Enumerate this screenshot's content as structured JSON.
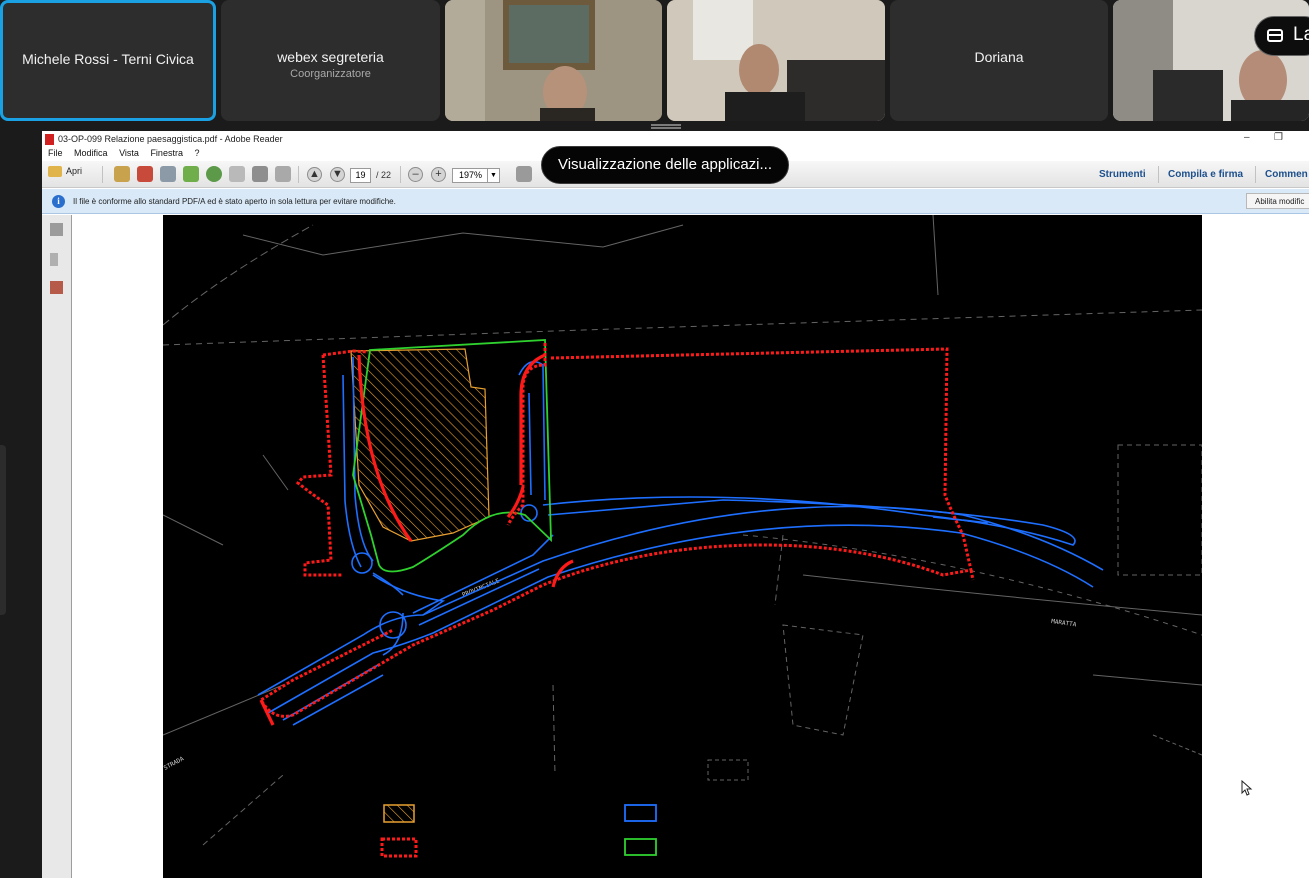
{
  "meeting": {
    "participants": [
      {
        "name": "Michele Rossi - Terni Civica",
        "role": "",
        "active": true
      },
      {
        "name": "webex segreteria",
        "role": "Coorganizzatore",
        "active": false
      },
      {
        "name": "",
        "role": "",
        "active": false,
        "video": true
      },
      {
        "name": "",
        "role": "",
        "active": false,
        "video": true
      },
      {
        "name": "Doriana",
        "role": "",
        "active": false
      },
      {
        "name": "",
        "role": "",
        "active": false,
        "video": true
      }
    ],
    "layout_button_label": "La",
    "share_tooltip": "Visualizzazione delle applicazi..."
  },
  "reader": {
    "window_title": "03-OP-099 Relazione paesaggistica.pdf - Adobe Reader",
    "window_controls": {
      "minimize": "–",
      "restore": "❐"
    },
    "menu": [
      "File",
      "Modifica",
      "Vista",
      "Finestra",
      "?"
    ],
    "toolbar": {
      "open_label": "Apri",
      "current_page": "19",
      "total_pages": "/ 22",
      "zoom": "197%",
      "zoom_out": "–",
      "zoom_in": "+",
      "right_tools": [
        "Strumenti",
        "Compila e firma",
        "Commen"
      ]
    },
    "infobar": {
      "message": "Il file è conforme allo standard PDF/A ed è stato aperto in sola lettura per evitare modifiche.",
      "enable_button": "Abilita modific"
    }
  },
  "drawing": {
    "road_labels": [
      "PROVINCIALE",
      "MARATTA",
      "STRADA"
    ],
    "colors": {
      "red": "#ff1a1a",
      "blue": "#1e6fff",
      "green": "#2fd12f",
      "orange": "#e8a030",
      "line": "#b8b8b8"
    }
  }
}
